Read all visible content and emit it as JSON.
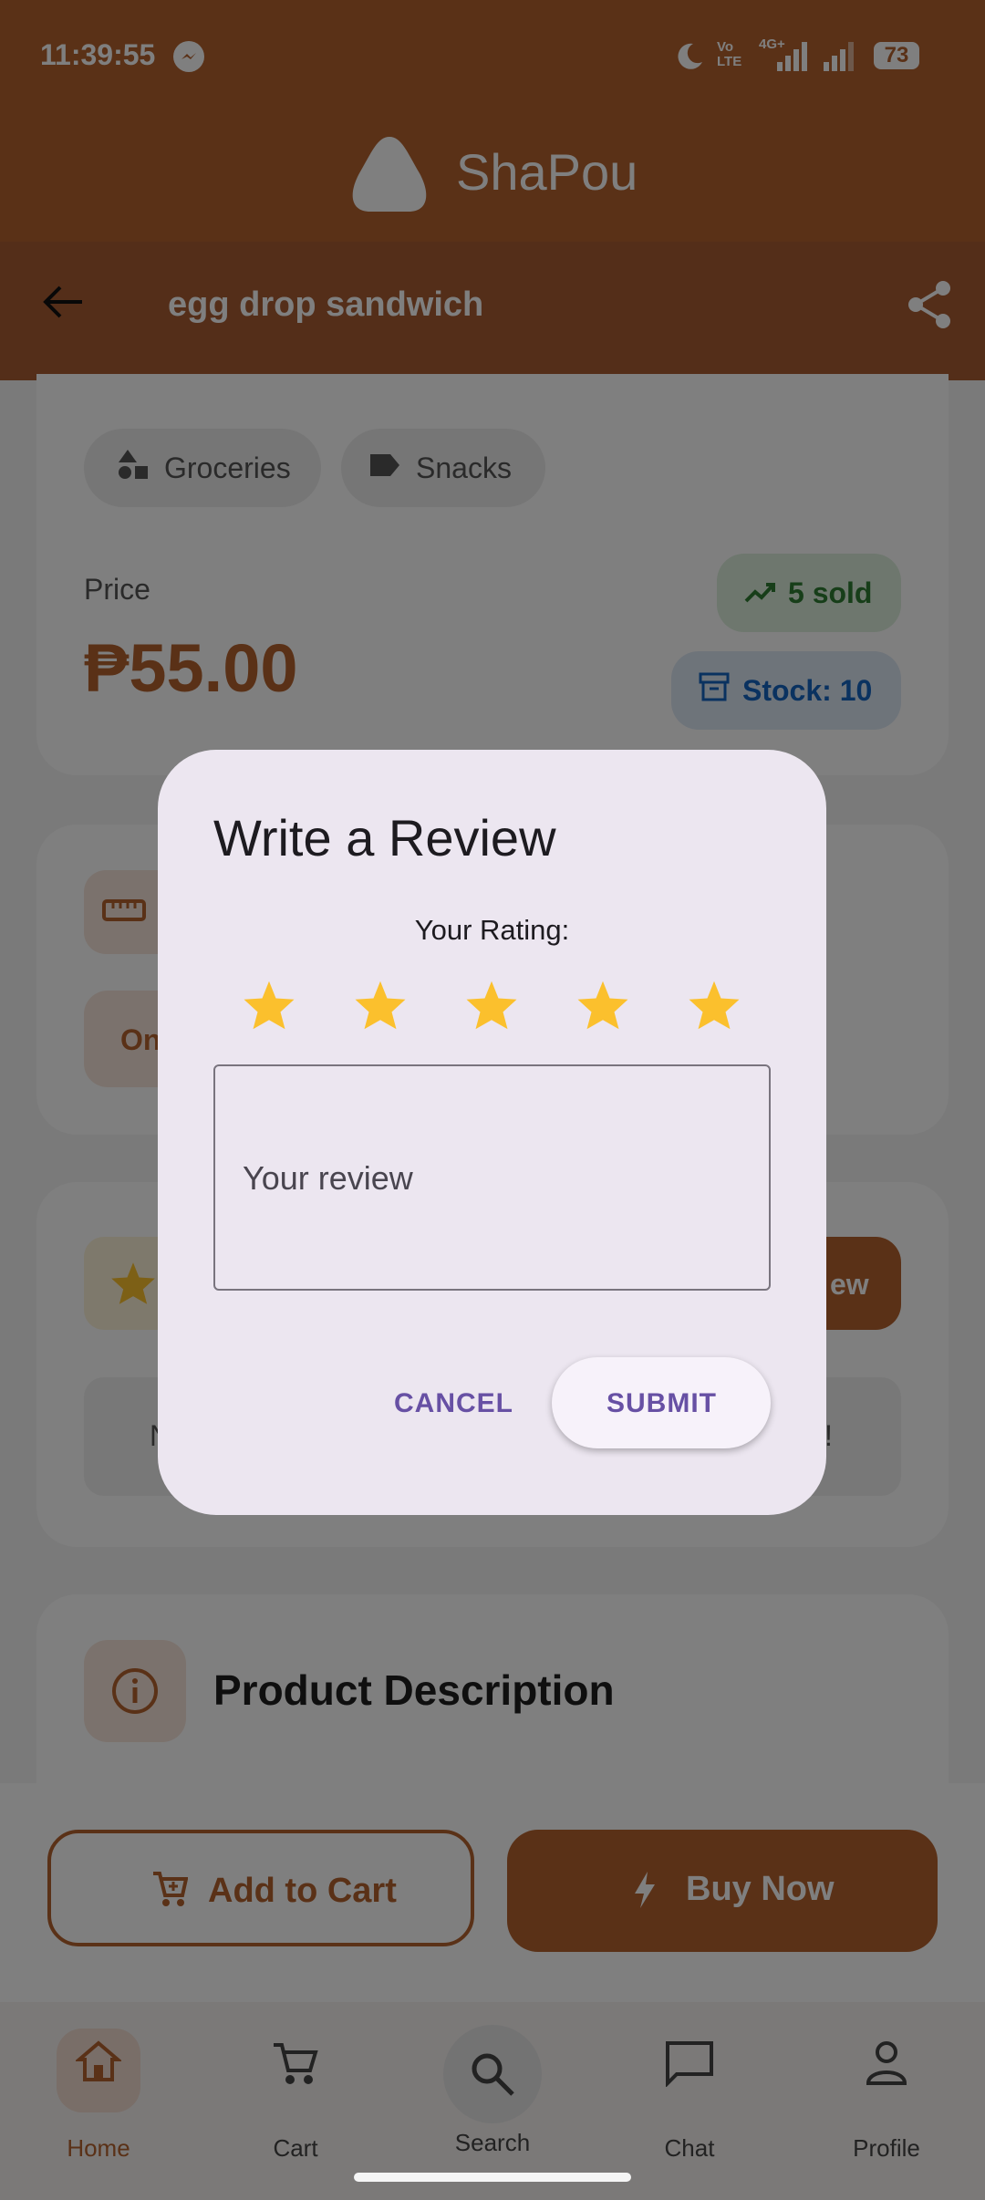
{
  "status_bar": {
    "time": "11:39:55",
    "battery": "73",
    "network": "4G+",
    "volte": "Vo\nLTE"
  },
  "app": {
    "title": "ShaPou"
  },
  "product_header": {
    "title": "egg drop sandwich"
  },
  "categories": [
    {
      "label": "Groceries",
      "icon": "category-icon"
    },
    {
      "label": "Snacks",
      "icon": "tag-icon"
    }
  ],
  "price": {
    "label": "Price",
    "value": "₱55.00"
  },
  "badges": {
    "sold": "5 sold",
    "stock": "Stock: 10"
  },
  "partial": {
    "option_label": "On",
    "review_btn_fragment": "ew",
    "fragment_left": "N",
    "fragment_right": "!"
  },
  "description": {
    "title": "Product Description"
  },
  "actions": {
    "add_to_cart": "Add to Cart",
    "buy_now": "Buy Now"
  },
  "nav": [
    {
      "label": "Home",
      "icon": "home-icon",
      "active": true
    },
    {
      "label": "Cart",
      "icon": "cart-icon",
      "active": false
    },
    {
      "label": "Search",
      "icon": "search-icon",
      "active": false
    },
    {
      "label": "Chat",
      "icon": "chat-icon",
      "active": false
    },
    {
      "label": "Profile",
      "icon": "profile-icon",
      "active": false
    }
  ],
  "dialog": {
    "title": "Write a Review",
    "rating_label": "Your Rating:",
    "rating": 5,
    "rating_max": 5,
    "review_placeholder": "Your review",
    "cancel": "CANCEL",
    "submit": "SUBMIT"
  },
  "colors": {
    "brand": "#b5622e",
    "star": "#fbc02d",
    "dialog_bg": "#ece6f0",
    "accent_text": "#6750a4"
  }
}
